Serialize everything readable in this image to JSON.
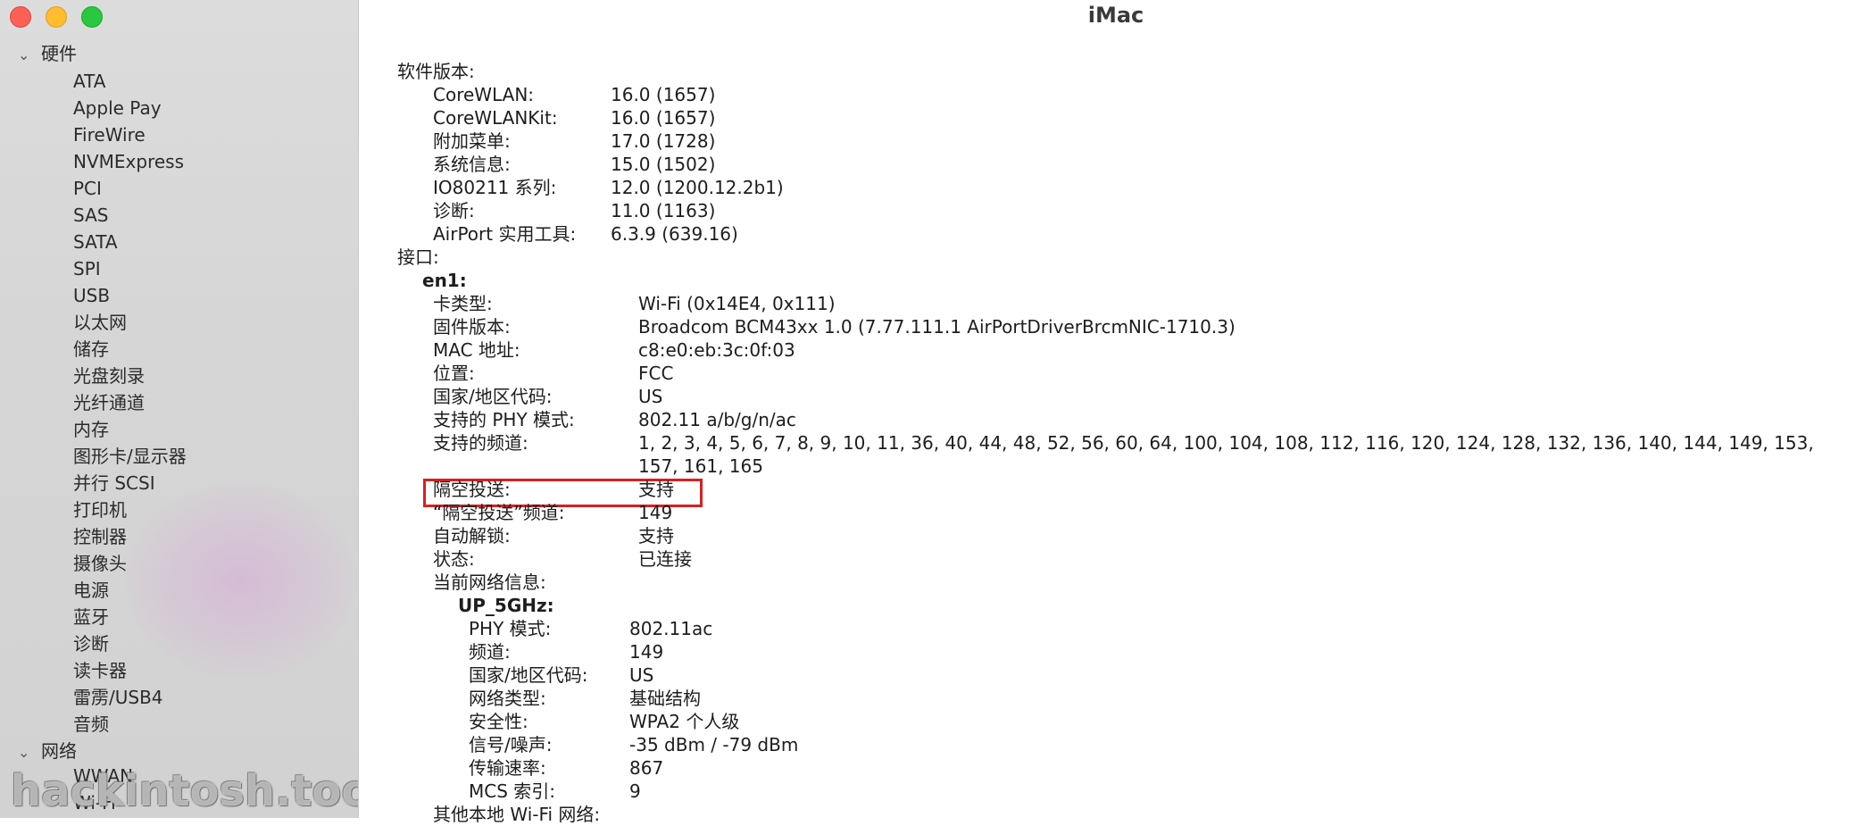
{
  "window": {
    "title": "iMac"
  },
  "sidebar": {
    "groups": [
      {
        "label": "硬件",
        "items": [
          "ATA",
          "Apple Pay",
          "FireWire",
          "NVMExpress",
          "PCI",
          "SAS",
          "SATA",
          "SPI",
          "USB",
          "以太网",
          "储存",
          "光盘刻录",
          "光纤通道",
          "内存",
          "图形卡/显示器",
          "并行 SCSI",
          "打印机",
          "控制器",
          "摄像头",
          "电源",
          "蓝牙",
          "诊断",
          "读卡器",
          "雷雳/USB4",
          "音频"
        ]
      },
      {
        "label": "网络",
        "items": [
          "WWAN",
          "Wi-Fi"
        ]
      }
    ],
    "watermark": "hackintosh.tools"
  },
  "software": {
    "heading": "软件版本:",
    "rows": [
      {
        "label": "CoreWLAN:",
        "value": "16.0 (1657)"
      },
      {
        "label": "CoreWLANKit:",
        "value": "16.0 (1657)"
      },
      {
        "label": "附加菜单:",
        "value": "17.0 (1728)"
      },
      {
        "label": "系统信息:",
        "value": "15.0 (1502)"
      },
      {
        "label": "IO80211 系列:",
        "value": "12.0 (1200.12.2b1)"
      },
      {
        "label": "诊断:",
        "value": "11.0 (1163)"
      },
      {
        "label": "AirPort 实用工具:",
        "value": "6.3.9 (639.16)"
      }
    ]
  },
  "interfaces": {
    "heading": "接口:",
    "name": "en1:",
    "rows": [
      {
        "label": "卡类型:",
        "value": "Wi-Fi  (0x14E4, 0x111)"
      },
      {
        "label": "固件版本:",
        "value": "Broadcom BCM43xx 1.0 (7.77.111.1 AirPortDriverBrcmNIC-1710.3)"
      },
      {
        "label": "MAC 地址:",
        "value": "c8:e0:eb:3c:0f:03"
      },
      {
        "label": "位置:",
        "value": "FCC"
      },
      {
        "label": "国家/地区代码:",
        "value": "US"
      },
      {
        "label": "支持的 PHY 模式:",
        "value": "802.11 a/b/g/n/ac"
      },
      {
        "label": "支持的频道:",
        "value": "1, 2, 3, 4, 5, 6, 7, 8, 9, 10, 11, 36, 40, 44, 48, 52, 56, 60, 64, 100, 104, 108, 112, 116, 120, 124, 128, 132, 136, 140, 144, 149, 153,",
        "value2": "157, 161, 165"
      },
      {
        "label": "隔空投送:",
        "value": "支持"
      },
      {
        "label": "“隔空投送”频道:",
        "value": "149"
      },
      {
        "label": "自动解锁:",
        "value": "支持"
      },
      {
        "label": "状态:",
        "value": "已连接"
      },
      {
        "label": "当前网络信息:",
        "value": ""
      }
    ],
    "network": {
      "ssid": "UP_5GHz:",
      "rows": [
        {
          "label": "PHY 模式:",
          "value": "802.11ac"
        },
        {
          "label": "频道:",
          "value": "149"
        },
        {
          "label": "国家/地区代码:",
          "value": "US"
        },
        {
          "label": "网络类型:",
          "value": "基础结构"
        },
        {
          "label": "安全性:",
          "value": "WPA2 个人级"
        },
        {
          "label": "信号/噪声:",
          "value": "-35 dBm / -79 dBm"
        },
        {
          "label": "传输速率:",
          "value": "867"
        },
        {
          "label": "MCS 索引:",
          "value": "9"
        }
      ]
    },
    "other_networks": "其他本地 Wi-Fi 网络:"
  },
  "colors": {
    "highlight": "#d82020",
    "sidebar_bg": "#d6d6d6"
  }
}
